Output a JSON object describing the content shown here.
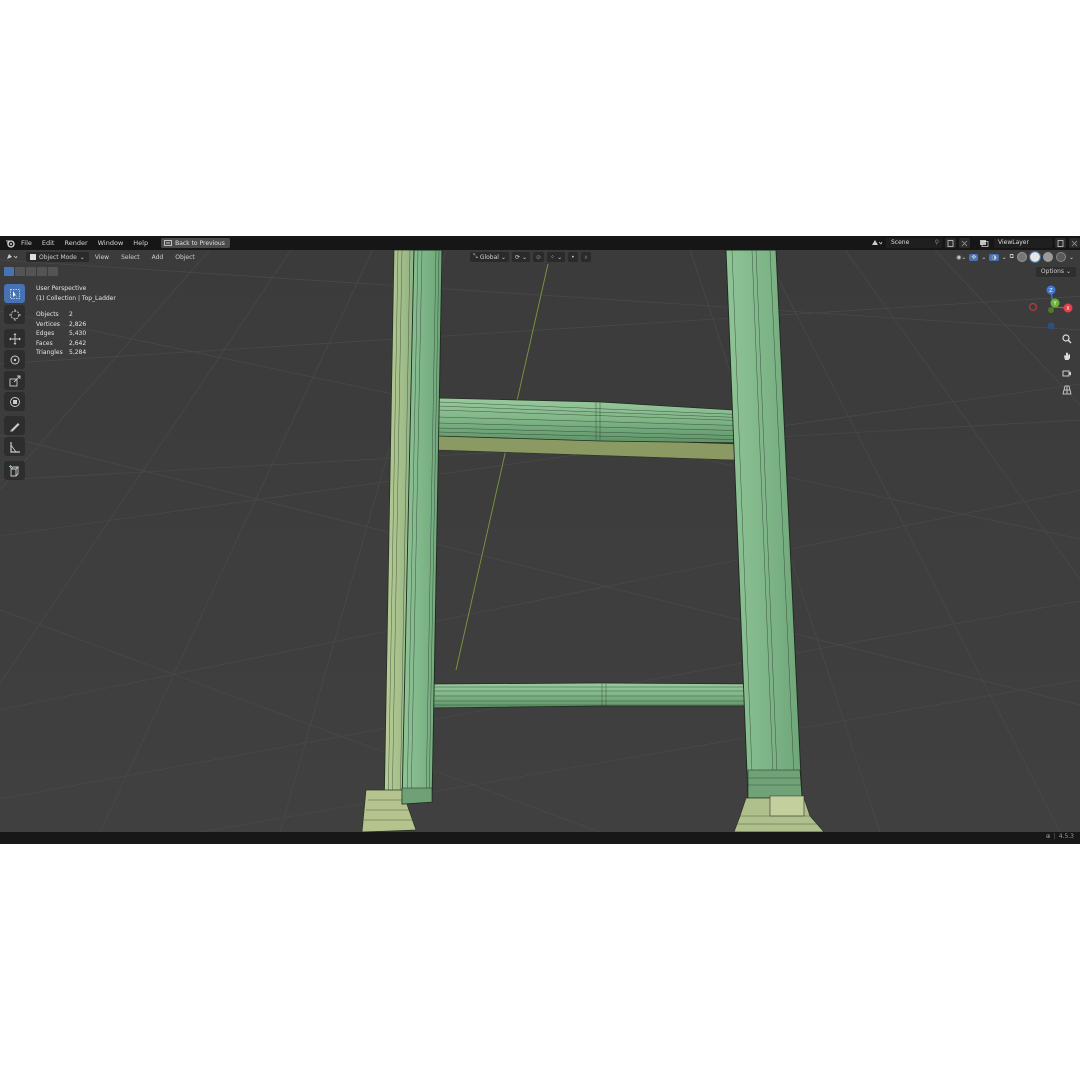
{
  "menubar": {
    "items": [
      "File",
      "Edit",
      "Render",
      "Window",
      "Help"
    ],
    "back_button": "Back to Previous",
    "scene": "Scene",
    "view_layer": "ViewLayer"
  },
  "viewport_header": {
    "mode": "Object Mode",
    "menus": [
      "View",
      "Select",
      "Add",
      "Object"
    ],
    "transform_orientation": "Global",
    "options": "Options"
  },
  "overlay": {
    "view_name": "User Perspective",
    "collection": "(1) Collection | Top_Ladder",
    "stats": [
      {
        "label": "Objects",
        "value": "2"
      },
      {
        "label": "Vertices",
        "value": "2,826"
      },
      {
        "label": "Edges",
        "value": "5,430"
      },
      {
        "label": "Faces",
        "value": "2,642"
      },
      {
        "label": "Triangles",
        "value": "5,284"
      }
    ]
  },
  "gizmo": {
    "z_label": "Z",
    "x_label": "X",
    "y_label": "Y",
    "colors": {
      "x": "#e0404a",
      "y": "#6bb536",
      "z": "#3d7ad6"
    }
  },
  "status": {
    "version": "4.5.3"
  },
  "colors": {
    "mesh_face": "#86b98c",
    "mesh_dark": "#5f8e66",
    "wire": "#1d2a1d",
    "select_blue": "#4772b3",
    "background": "#3d3d3d"
  }
}
